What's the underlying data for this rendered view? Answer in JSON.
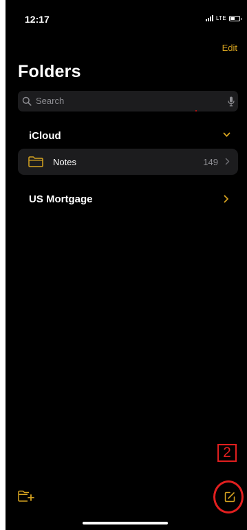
{
  "status_bar": {
    "time": "12:17",
    "network": "LTE",
    "battery_level": 0.5
  },
  "nav": {
    "edit_label": "Edit",
    "title": "Folders"
  },
  "search": {
    "placeholder": "Search"
  },
  "sections": [
    {
      "name": "iCloud",
      "expanded": true,
      "folders": [
        {
          "label": "Notes",
          "count": "149"
        }
      ]
    },
    {
      "name": "US Mortgage",
      "expanded": false
    }
  ],
  "annotation": {
    "label": "2"
  },
  "toolbar": {
    "new_folder_icon": "folder-plus-icon",
    "compose_icon": "compose-icon"
  },
  "colors": {
    "accent": "#d6a320",
    "background": "#000000",
    "row_background": "#1c1c1e",
    "secondary_text": "#8e8e93",
    "annotation": "#e11f1f"
  }
}
